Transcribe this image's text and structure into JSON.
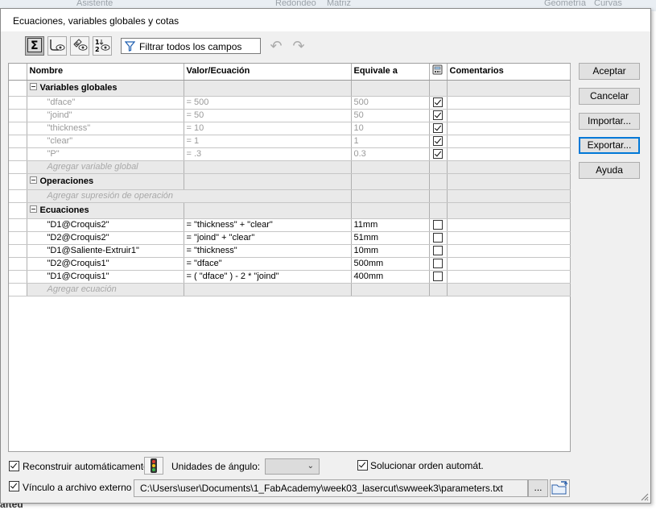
{
  "background": {
    "ribbon": [
      "Asistente",
      "Redondeo",
      "Matriz",
      "Geometría",
      "Curvas"
    ],
    "fragment": "afted"
  },
  "dialog": {
    "title": "Ecuaciones, variables globales y cotas"
  },
  "toolbar": {
    "buttons": [
      "equation-view-icon",
      "sketch-equation-view-icon",
      "dimension-view-icon",
      "ordered-view-icon"
    ],
    "filter_placeholder": "Filtrar todos los campos",
    "undo_icon": "undo-icon",
    "redo_icon": "redo-icon"
  },
  "grid": {
    "columns": [
      "Nombre",
      "Valor/Ecuación",
      "Equivale a",
      "",
      "Comentarios"
    ],
    "sections": {
      "globals": {
        "label": "Variables globales",
        "rows": [
          {
            "name": "\"dface\"",
            "value": "= 500",
            "equiv": "500",
            "checked": true
          },
          {
            "name": "\"joind\"",
            "value": "= 50",
            "equiv": "50",
            "checked": true
          },
          {
            "name": "\"thickness\"",
            "value": "= 10",
            "equiv": "10",
            "checked": true
          },
          {
            "name": "\"clear\"",
            "value": "= 1",
            "equiv": "1",
            "checked": true
          },
          {
            "name": "\"P\"",
            "value": "= .3",
            "equiv": "0.3",
            "checked": true
          }
        ],
        "add_label": "Agregar variable global"
      },
      "operations": {
        "label": "Operaciones",
        "add_label": "Agregar supresión de operación"
      },
      "equations": {
        "label": "Ecuaciones",
        "rows": [
          {
            "name": "\"D1@Croquis2\"",
            "value": "= \"thickness\" + \"clear\"",
            "equiv": "11mm",
            "checked": false
          },
          {
            "name": "\"D2@Croquis2\"",
            "value": "= \"joind\" + \"clear\"",
            "equiv": "51mm",
            "checked": false
          },
          {
            "name": "\"D1@Saliente-Extruir1\"",
            "value": "= \"thickness\"",
            "equiv": "10mm",
            "checked": false
          },
          {
            "name": "\"D2@Croquis1\"",
            "value": "= \"dface\"",
            "equiv": "500mm",
            "checked": false
          },
          {
            "name": "\"D1@Croquis1\"",
            "value": "= ( \"dface\" ) - 2 * \"joind\"",
            "equiv": "400mm",
            "checked": false
          }
        ],
        "add_label": "Agregar ecuación"
      }
    }
  },
  "buttons": {
    "accept": "Aceptar",
    "cancel": "Cancelar",
    "import": "Importar...",
    "export": "Exportar...",
    "help": "Ayuda"
  },
  "bottom": {
    "auto_rebuild_label": "Reconstruir automáticamente",
    "auto_rebuild_checked": true,
    "angle_units_label": "Unidades de ángulo:",
    "angle_units_value": "",
    "auto_solve_label": "Solucionar orden automát.",
    "auto_solve_checked": true,
    "link_label": "Vínculo a archivo externo",
    "link_checked": true,
    "link_path": "C:\\Users\\user\\Documents\\1_FabAcademy\\week03_lasercut\\swweek3\\parameters.txt",
    "browse_label": "..."
  }
}
